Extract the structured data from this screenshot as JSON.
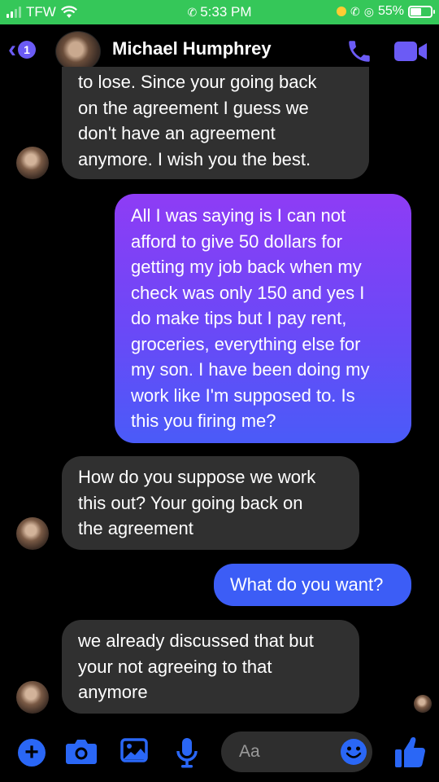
{
  "status_bar": {
    "carrier": "TFW",
    "time": "5:33 PM",
    "battery": "55%",
    "background": "#35c759"
  },
  "header": {
    "back_badge": "1",
    "contact_name": "Michael Humphrey",
    "icons": [
      "back-chevron-icon",
      "phone-call-icon",
      "video-call-icon"
    ],
    "accent": "#6b5bf5"
  },
  "messages": [
    {
      "direction": "incoming",
      "lines": [
        "to lose. Since your going back",
        "on the agreement I guess we",
        "don't have an agreement",
        "anymore. I wish you the best."
      ]
    },
    {
      "direction": "outgoing",
      "lines": [
        "All I was saying is I can not",
        "afford to give 50 dollars for",
        "getting my job back when my",
        "check was only 150 and yes I",
        "do make tips but I pay rent,",
        "groceries, everything else for",
        "my son. I have been doing my",
        "work like I'm supposed to. Is",
        "this you firing me?"
      ]
    },
    {
      "direction": "incoming",
      "lines": [
        "How do you suppose we work",
        "this out? Your going back on",
        "the agreement"
      ]
    },
    {
      "direction": "outgoing",
      "lines": [
        "What do you want?"
      ]
    },
    {
      "direction": "incoming",
      "lines": [
        "we already discussed that but",
        "your not agreeing to that",
        "anymore"
      ]
    }
  ],
  "composer": {
    "placeholder": "Aa",
    "icons": [
      "plus-icon",
      "camera-icon",
      "gallery-icon",
      "microphone-icon",
      "emoji-icon",
      "thumbs-up-icon"
    ],
    "icon_color": "#2a67f6"
  }
}
